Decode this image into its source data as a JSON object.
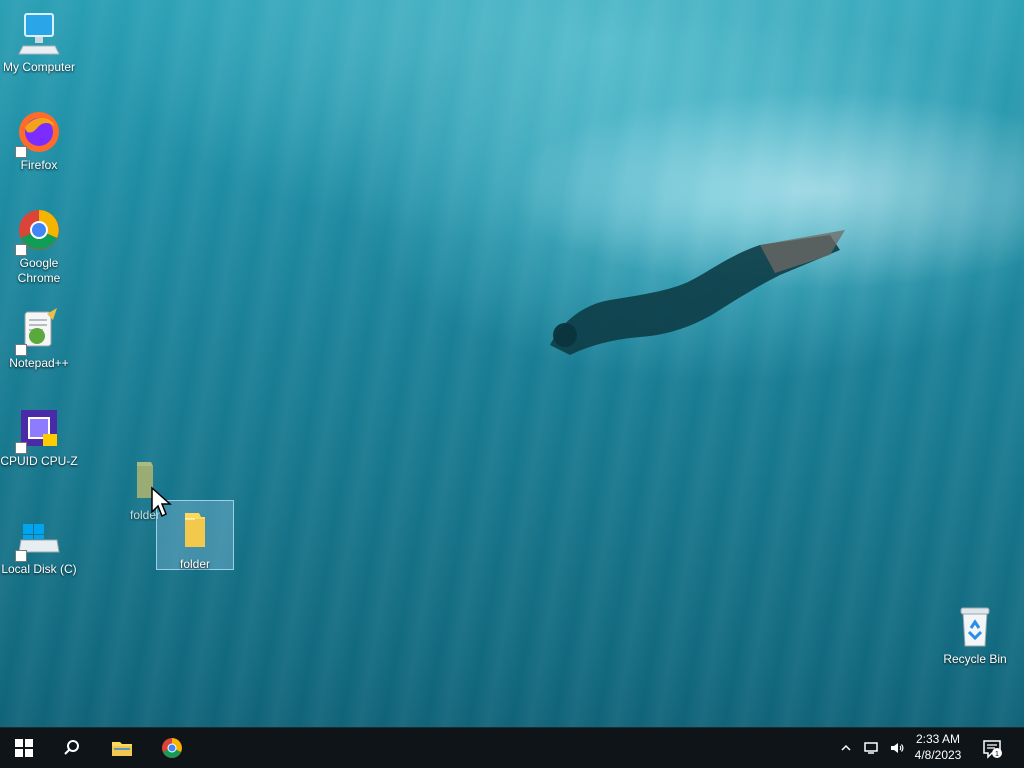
{
  "desktop": {
    "icons": [
      {
        "label": "My Computer"
      },
      {
        "label": "Firefox"
      },
      {
        "label": "Google Chrome"
      },
      {
        "label": "Notepad++"
      },
      {
        "label": "CPUID CPU-Z"
      },
      {
        "label": "Local Disk (C)"
      },
      {
        "label": "folder"
      },
      {
        "label": "folder"
      },
      {
        "label": "Recycle Bin"
      }
    ]
  },
  "taskbar": {
    "start": "start-icon",
    "search": "search-icon",
    "pinned": [
      {
        "name": "file-explorer-icon"
      },
      {
        "name": "chrome-icon"
      }
    ],
    "tray": {
      "time": "2:33 AM",
      "date": "4/8/2023",
      "notifications": "1"
    }
  },
  "colors": {
    "taskbar": "#0f1418",
    "selection": "#78b4d2",
    "water_top": "#2a9fb4",
    "water_bottom": "#0f5f74"
  }
}
